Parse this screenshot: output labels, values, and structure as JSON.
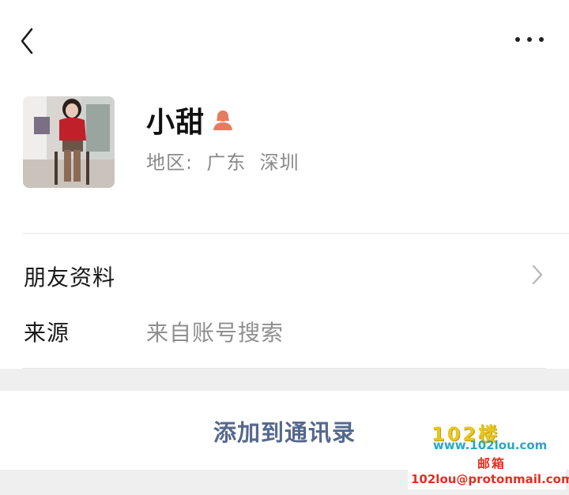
{
  "header": {
    "back_icon": "chevron-left-icon",
    "more_icon": "more-horizontal-icon"
  },
  "profile": {
    "name": "小甜",
    "gender_icon": "female-user-icon",
    "gender_color": "#e57c62",
    "region": "地区:  广东  深圳"
  },
  "rows": {
    "friend_info_label": "朋友资料",
    "source_label": "来源",
    "source_value": "来自账号搜索"
  },
  "action": {
    "add_contact_label": "添加到通讯录",
    "link_color": "#55688e"
  },
  "watermark": {
    "title": "102楼",
    "site": "www.102lou.com",
    "mail": "邮箱",
    "address": "102lou@protonmail.com"
  }
}
